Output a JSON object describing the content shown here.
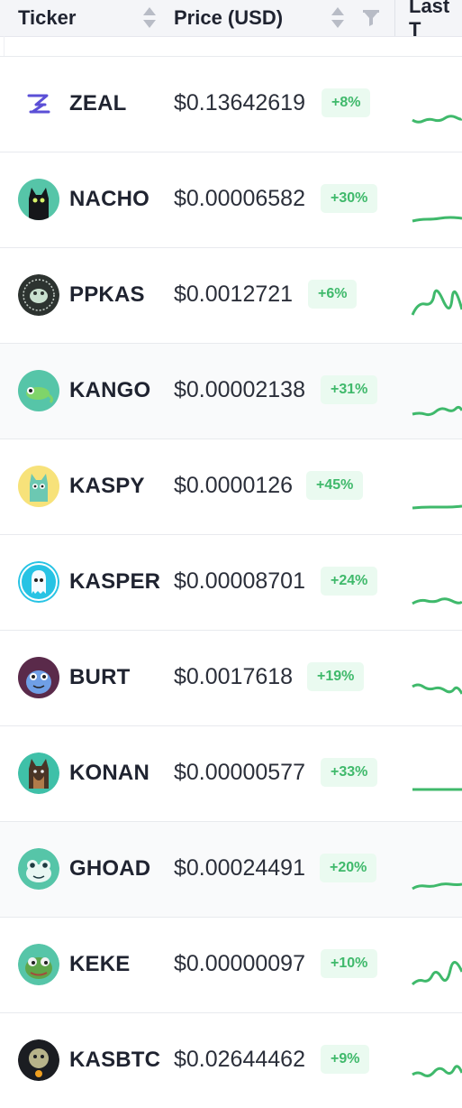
{
  "header": {
    "ticker": "Ticker",
    "price": "Price (USD)",
    "last": "Last T"
  },
  "colors": {
    "up": "#3fb96b",
    "badge_bg": "#eafaf0"
  },
  "rows": [
    {
      "ticker": "ZEAL",
      "price": "$0.13642619",
      "change": "+8%",
      "icon": "zeal-logo-icon"
    },
    {
      "ticker": "NACHO",
      "price": "$0.00006582",
      "change": "+30%",
      "icon": "black-cat-icon"
    },
    {
      "ticker": "PPKAS",
      "price": "$0.0012721",
      "change": "+6%",
      "icon": "pepe-coin-icon"
    },
    {
      "ticker": "KANGO",
      "price": "$0.00002138",
      "change": "+31%",
      "icon": "chameleon-icon"
    },
    {
      "ticker": "KASPY",
      "price": "$0.0000126",
      "change": "+45%",
      "icon": "cartoon-cat-icon"
    },
    {
      "ticker": "KASPER",
      "price": "$0.00008701",
      "change": "+24%",
      "icon": "ghost-icon"
    },
    {
      "ticker": "BURT",
      "price": "$0.0017618",
      "change": "+19%",
      "icon": "blue-creature-icon"
    },
    {
      "ticker": "KONAN",
      "price": "$0.00000577",
      "change": "+33%",
      "icon": "dog-icon"
    },
    {
      "ticker": "GHOAD",
      "price": "$0.00024491",
      "change": "+20%",
      "icon": "frog-face-icon"
    },
    {
      "ticker": "KEKE",
      "price": "$0.00000097",
      "change": "+10%",
      "icon": "pepe-frog-icon"
    },
    {
      "ticker": "KASBTC",
      "price": "$0.02644462",
      "change": "+9%",
      "icon": "kasbtc-icon"
    }
  ]
}
